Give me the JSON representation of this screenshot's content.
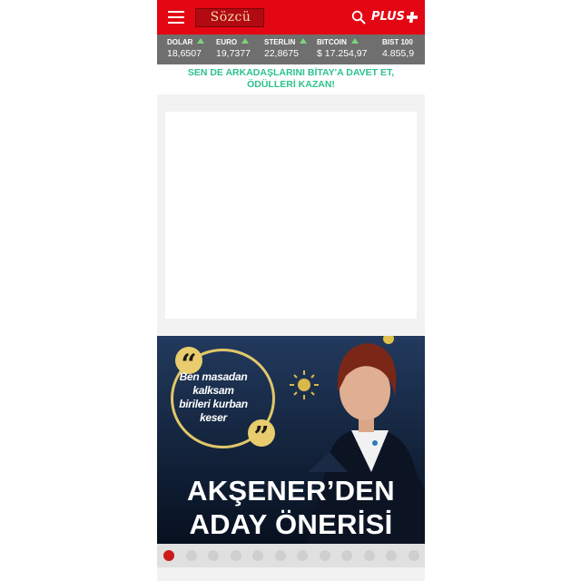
{
  "header": {
    "logo_text": "Sözcü",
    "plus_label": "PLUS",
    "brand_color": "#e30613"
  },
  "ticker": {
    "items": [
      {
        "name": "DOLAR",
        "value": "18,6507",
        "trend": "up"
      },
      {
        "name": "EURO",
        "value": "19,7377",
        "trend": "up"
      },
      {
        "name": "STERLIN",
        "value": "22,8675",
        "trend": "up"
      },
      {
        "name": "BITCOIN",
        "value": "$ 17.254,97",
        "trend": "up"
      },
      {
        "name": "BIST 100",
        "value": "4.855,9",
        "trend": "up"
      }
    ]
  },
  "promo": {
    "line1": "SEN DE ARKADAŞLARINI BİTAY'A DAVET ET,",
    "line2": "ÖDÜLLERİ KAZAN!",
    "color": "#2cc38a"
  },
  "hero": {
    "quote_text": "Ben masadan kalksam birileri kurban keser",
    "headline_line1": "AKŞENER’DEN",
    "headline_line2": "ADAY ÖNERİSİ"
  },
  "slider": {
    "count": 12,
    "active_index": 0
  },
  "icons": [
    "menu-icon",
    "search-icon",
    "plus-icon",
    "arrow-up-icon",
    "quote-icon"
  ]
}
